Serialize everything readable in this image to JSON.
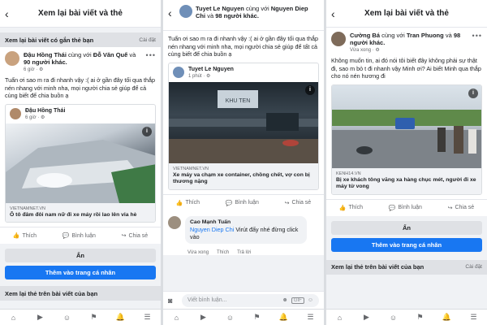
{
  "panels": [
    {
      "header": {
        "title": "Xem lại bài viết và thẻ"
      },
      "section": {
        "label": "Xem lại bài viết có gắn thẻ bạn",
        "right": "Cài đặt"
      },
      "post": {
        "author": "Đậu Hồng Thái",
        "with_word": "cùng với",
        "tagged": "Đỗ Văn Quế",
        "and_word": "và",
        "others": "90 người khác.",
        "time": "6 giờ · ⚙",
        "text": "Tuẩn ơi sao m ra đi nhanh vậy :( ai ở gần đây tối qua thắp nén nhang với minh nha, mọi người chia sẻ giúp để cả cùng biết để chia buồn ạ",
        "shared_author": "Đậu Hồng Thái",
        "shared_time": "6 giờ · ⚙",
        "link_source": "VIETNAMNET.VN",
        "link_title": "Ô tô đâm đôi nam nữ đi xe máy rồi lao lên vỉa hè"
      },
      "actions": {
        "like": "Thích",
        "comment": "Bình luận",
        "share": "Chia sẻ"
      },
      "hide_button": "Ẩn",
      "add_button": "Thêm vào trang cá nhân",
      "footer_section": "Xem lại thẻ trên bài viết của bạn"
    },
    {
      "header": {
        "author": "Tuyet Le Nguyen",
        "with_word": "cùng với",
        "tagged": "Nguyen Diep Chi",
        "and_word": "và",
        "others": "98 người khác."
      },
      "post": {
        "text": "Tuẩn ơi sao m ra đi nhanh vậy :( ai ở gần đây tối qua thắp nén nhang với minh nha, mọi người chia sẻ giúp để tất cả cùng biết để chia buồn ạ",
        "shared_author": "Tuyet Le Nguyen",
        "shared_time": "1 phút · ⚙",
        "photo_sign": "KHU TEN",
        "link_source": "VIETNAMNET.VN",
        "link_title": "Xe máy va chạm xe container, chồng chết, vợ con bị thương nặng"
      },
      "actions": {
        "like": "Thích",
        "comment": "Bình luận",
        "share": "Chia sẻ"
      },
      "comment": {
        "author": "Cao Mạnh Tuấn",
        "mention": "Nguyen Diep Chi",
        "text": " Virút đấy nhé đừng click vào",
        "time": "Vừa xong",
        "like": "Thích",
        "reply": "Trả lời"
      },
      "input": {
        "placeholder": "Viết bình luận...",
        "gif": "GIF"
      }
    },
    {
      "header": {
        "title": "Xem lại bài viết và thẻ"
      },
      "post": {
        "author": "Cường Bá",
        "with_word": "cùng với",
        "tagged": "Tran Phuong",
        "and_word": "và",
        "others": "98 người khác.",
        "time": "Vừa xong · ⚙",
        "text": "Không muốn tin, ai đó nói tôi biết đây không phải sự thật đi, sao m bỏ t đi nhanh vậy Minh ơi? Ai biết Minh qua thắp cho nó nén hương đi",
        "link_source": "KENH14.VN",
        "link_title": "Bị xe khách tông văng xa hàng chục mét, người đi xe máy tử vong"
      },
      "actions": {
        "like": "Thích",
        "comment": "Bình luận",
        "share": "Chia sẻ"
      },
      "hide_button": "Ẩn",
      "add_button": "Thêm vào trang cá nhân",
      "section": {
        "label": "Xem lại thẻ trên bài viết của bạn",
        "right": "Cài đặt"
      }
    }
  ],
  "colors": {
    "accent": "#1877f2",
    "background": "#f0f2f5"
  },
  "nav_icons": [
    "home-icon",
    "watch-icon",
    "groups-icon",
    "flag-icon",
    "notifications-icon",
    "menu-icon"
  ]
}
